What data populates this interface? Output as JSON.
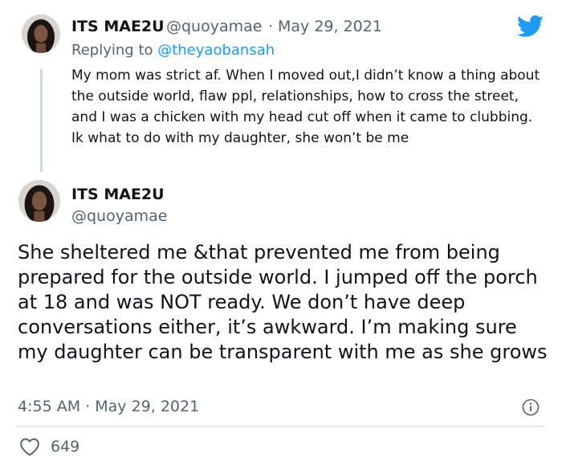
{
  "reply_tweet": {
    "display_name": "ITS MAE2U",
    "handle": "@quoyamae",
    "separator": "·",
    "date": "May 29, 2021",
    "replying_prefix": "Replying to",
    "replying_to": "@theyaobansah",
    "text": "My mom was strict af. When I moved out,I didn’t know a thing about the outside world, flaw ppl, relationships, how to cross the street, and I was a chicken with my head cut off when it came to clubbing. Ik what to do with my daughter, she won’t be me"
  },
  "main_tweet": {
    "display_name": "ITS MAE2U",
    "handle": "@quoyamae",
    "text": "She sheltered me &that prevented me from being prepared for the outside world. I jumped off the porch at 18 and was NOT ready. We don’t have deep conversations either, it’s awkward. I’m making sure my daughter can be transparent with me as she grows",
    "time": "4:55 AM",
    "separator": "·",
    "date": "May 29, 2021",
    "like_count": "649"
  },
  "icons": {
    "brand": "twitter-bird-icon",
    "info": "info-icon",
    "like": "heart-icon"
  },
  "colors": {
    "brand_blue": "#1d9bf0",
    "text_primary": "#0f1419",
    "text_secondary": "#536471",
    "divider": "#cfd9de"
  }
}
